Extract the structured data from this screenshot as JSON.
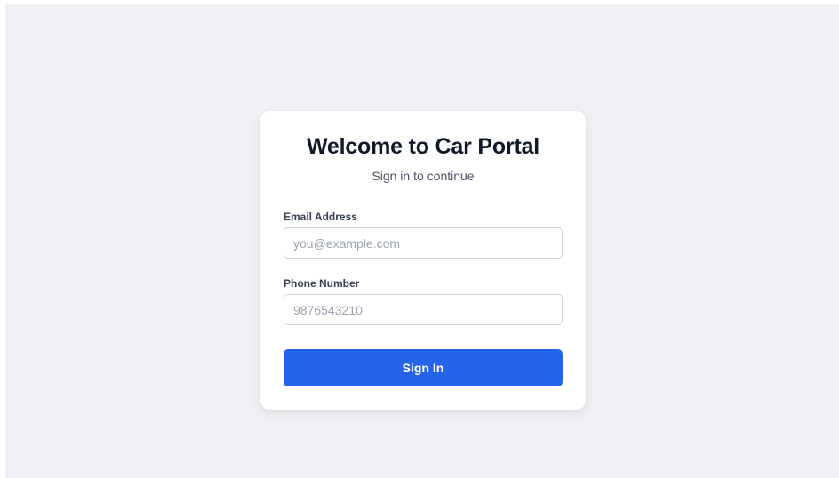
{
  "login": {
    "title": "Welcome to Car Portal",
    "subtitle": "Sign in to continue",
    "email_label": "Email Address",
    "email_placeholder": "you@example.com",
    "email_value": "",
    "phone_label": "Phone Number",
    "phone_placeholder": "9876543210",
    "phone_value": "",
    "submit_label": "Sign In"
  },
  "colors": {
    "page_background": "#f0f1f4",
    "card_background": "#ffffff",
    "primary_button": "#2563eb",
    "title_text": "#111827"
  }
}
